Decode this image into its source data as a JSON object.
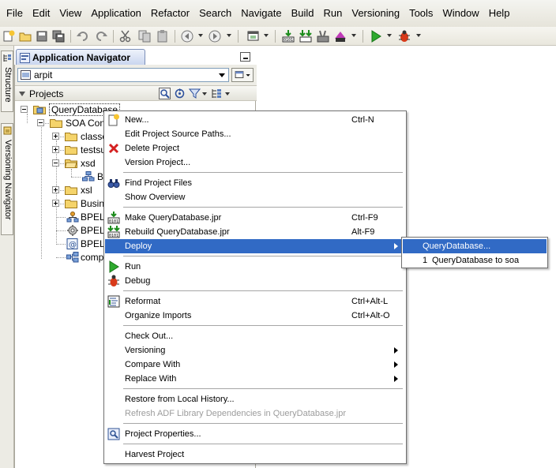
{
  "menubar": {
    "items": [
      "File",
      "Edit",
      "View",
      "Application",
      "Refactor",
      "Search",
      "Navigate",
      "Build",
      "Run",
      "Versioning",
      "Tools",
      "Window",
      "Help"
    ]
  },
  "sidebar": {
    "tabs": [
      "Structure",
      "Versioning Navigator"
    ]
  },
  "navigator": {
    "title": "Application Navigator",
    "application": "arpit",
    "section": "Projects"
  },
  "tree": {
    "items": [
      {
        "label": "QueryDatabase"
      },
      {
        "label": "SOA Cont"
      },
      {
        "label": "classe"
      },
      {
        "label": "testsu"
      },
      {
        "label": "xsd"
      },
      {
        "label": "Bl"
      },
      {
        "label": "xsl"
      },
      {
        "label": "Busine"
      },
      {
        "label": "BPELF"
      },
      {
        "label": "BPELF"
      },
      {
        "label": "BPELF"
      },
      {
        "label": "compo"
      }
    ]
  },
  "context_menu": {
    "items": [
      {
        "label": "New...",
        "accel": "Ctrl-N",
        "icon": "new-icon"
      },
      {
        "label": "Edit Project Source Paths..."
      },
      {
        "label": "Delete Project",
        "icon": "delete-icon"
      },
      {
        "label": "Version Project..."
      },
      {
        "label": "Find Project Files",
        "icon": "binoculars-icon"
      },
      {
        "label": "Show Overview"
      },
      {
        "label": "Make QueryDatabase.jpr",
        "accel": "Ctrl-F9",
        "icon": "make-icon"
      },
      {
        "label": "Rebuild QueryDatabase.jpr",
        "accel": "Alt-F9",
        "icon": "rebuild-icon"
      },
      {
        "label": "Deploy",
        "submenu": true
      },
      {
        "label": "Run",
        "icon": "run-icon"
      },
      {
        "label": "Debug",
        "icon": "debug-icon"
      },
      {
        "label": "Reformat",
        "accel": "Ctrl+Alt-L",
        "icon": "reformat-icon"
      },
      {
        "label": "Organize Imports",
        "accel": "Ctrl+Alt-O"
      },
      {
        "label": "Check Out..."
      },
      {
        "label": "Versioning",
        "submenu": true
      },
      {
        "label": "Compare With",
        "submenu": true
      },
      {
        "label": "Replace With",
        "submenu": true
      },
      {
        "label": "Restore from Local History..."
      },
      {
        "label": "Refresh ADF Library Dependencies in QueryDatabase.jpr",
        "disabled": true
      },
      {
        "label": "Project Properties...",
        "icon": "properties-icon"
      },
      {
        "label": "Harvest Project"
      }
    ]
  },
  "deploy_submenu": {
    "items": [
      {
        "label": "QueryDatabase..."
      },
      {
        "prefix": "1",
        "label": "QueryDatabase to soa"
      }
    ]
  },
  "colors": {
    "selection": "#316ac5",
    "menu_border": "#6f6f6f"
  }
}
